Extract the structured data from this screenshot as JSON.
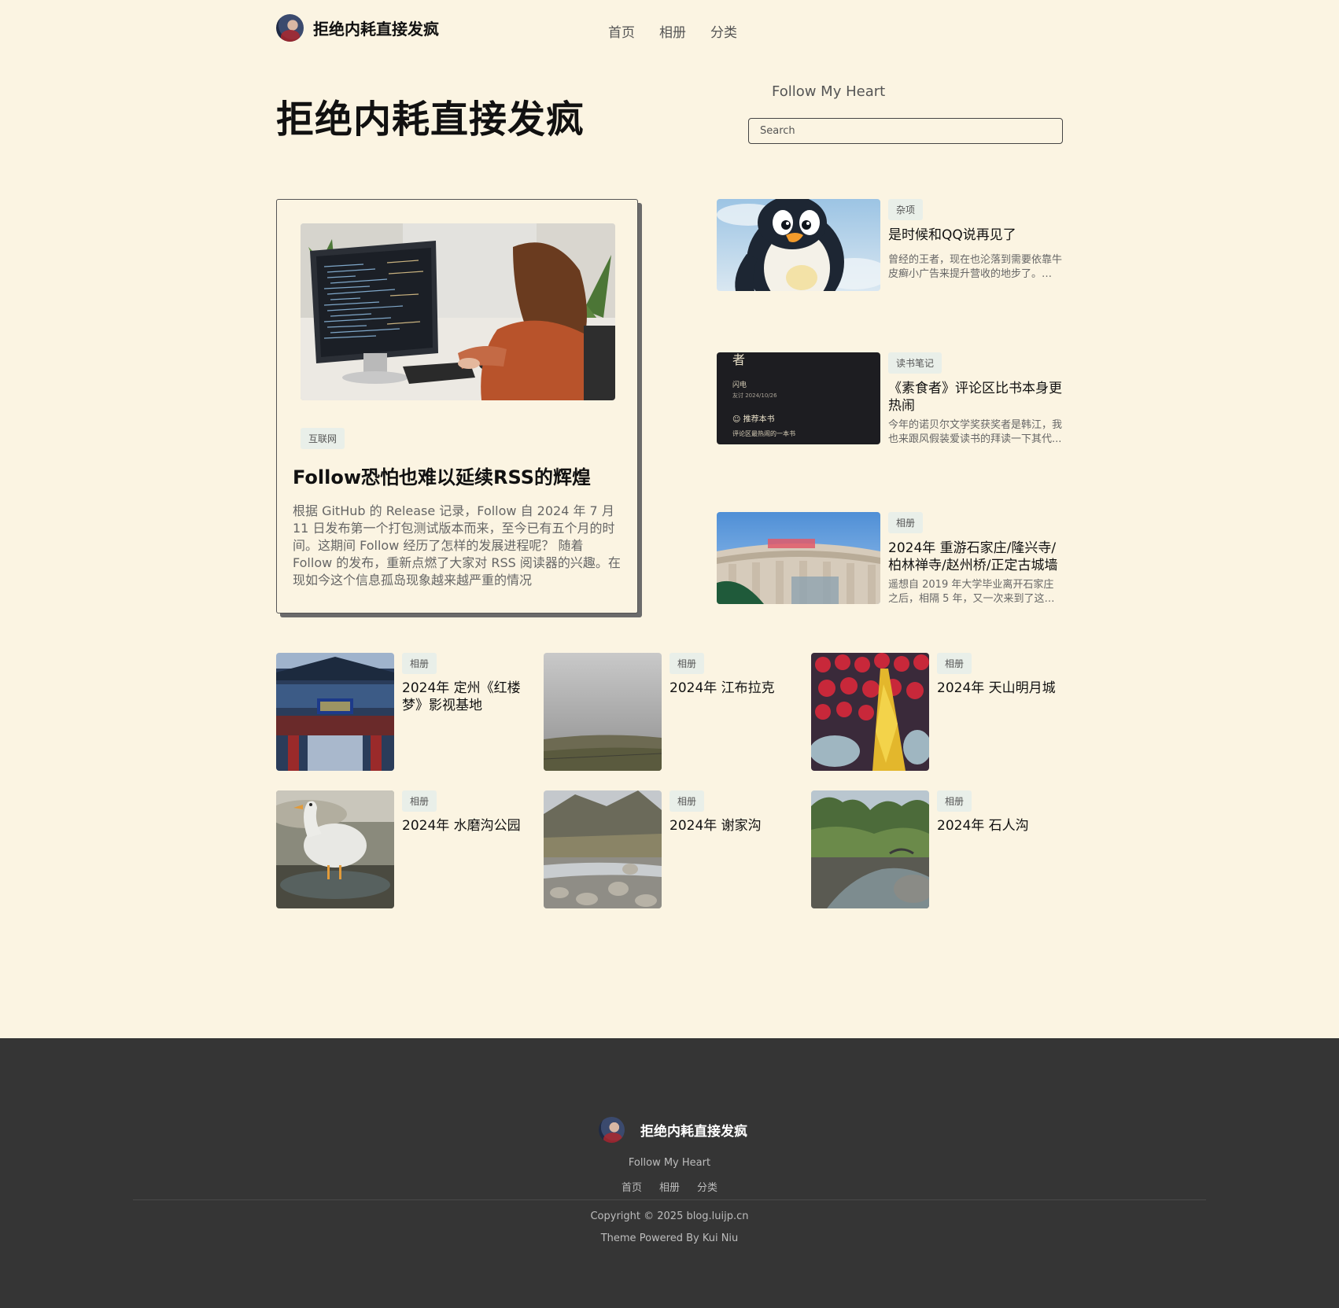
{
  "site": {
    "name": "拒绝内耗直接发疯",
    "tagline": "Follow My Heart"
  },
  "nav": [
    "首页",
    "相册",
    "分类"
  ],
  "hero": {
    "title": "拒绝内耗直接发疯",
    "tagline": "Follow My Heart",
    "search_placeholder": "Search"
  },
  "featured": {
    "tag": "互联网",
    "title": "Follow恐怕也难以延续RSS的辉煌",
    "excerpt": "根据 GitHub 的 Release 记录，Follow 自 2024 年 7 月 11 日发布第一个打包测试版本而来，至今已有五个月的时间。这期间 Follow 经历了怎样的发展进程呢？ 随着 Follow 的发布，重新点燃了大家对 RSS 阅读器的兴趣。在现如今这个信息孤岛现象越来越严重的情况"
  },
  "side_posts": [
    {
      "tag": "杂项",
      "title": "是时候和QQ说再见了",
      "excerpt": "曾经的王者，现在也沦落到需要依靠牛皮癣小广告来提升营收的地步了。 细..."
    },
    {
      "tag": "读书笔记",
      "title": "《素食者》评论区比书本身更热闹",
      "excerpt": "今年的诺贝尔文学奖获奖者是韩江，我也来跟风假装爱读书的拜读一下其代...",
      "thumb_text": {
        "heading": "者",
        "line1": "闪电",
        "line2": "友讨 2024/10/26",
        "line3": "☺ 推荐本书",
        "line4": "评论区最热闹的一本书"
      }
    },
    {
      "tag": "相册",
      "title": "2024年 重游石家庄/隆兴寺/柏林禅寺/赵州桥/正定古城墙",
      "excerpt": "遥想自 2019 年大学毕业离开石家庄之后，相隔 5 年，又一次来到了这座城..."
    }
  ],
  "grid_posts": [
    {
      "tag": "相册",
      "title": "2024年 定州《红楼梦》影视基地"
    },
    {
      "tag": "相册",
      "title": "2024年 江布拉克"
    },
    {
      "tag": "相册",
      "title": "2024年 天山明月城"
    },
    {
      "tag": "相册",
      "title": "2024年 水磨沟公园"
    },
    {
      "tag": "相册",
      "title": "2024年 谢家沟"
    },
    {
      "tag": "相册",
      "title": "2024年 石人沟"
    }
  ],
  "footer": {
    "name": "拒绝内耗直接发疯",
    "tagline": "Follow My Heart",
    "nav": [
      "首页",
      "相册",
      "分类"
    ],
    "copyright": "Copyright © 2025 blog.luijp.cn",
    "powered": "Theme Powered By Kui Niu"
  },
  "colors": {
    "background": "#fbf4e2",
    "footer_bg": "#353535",
    "tag_bg": "#e9efe9",
    "text": "#111111",
    "muted": "#666666"
  }
}
